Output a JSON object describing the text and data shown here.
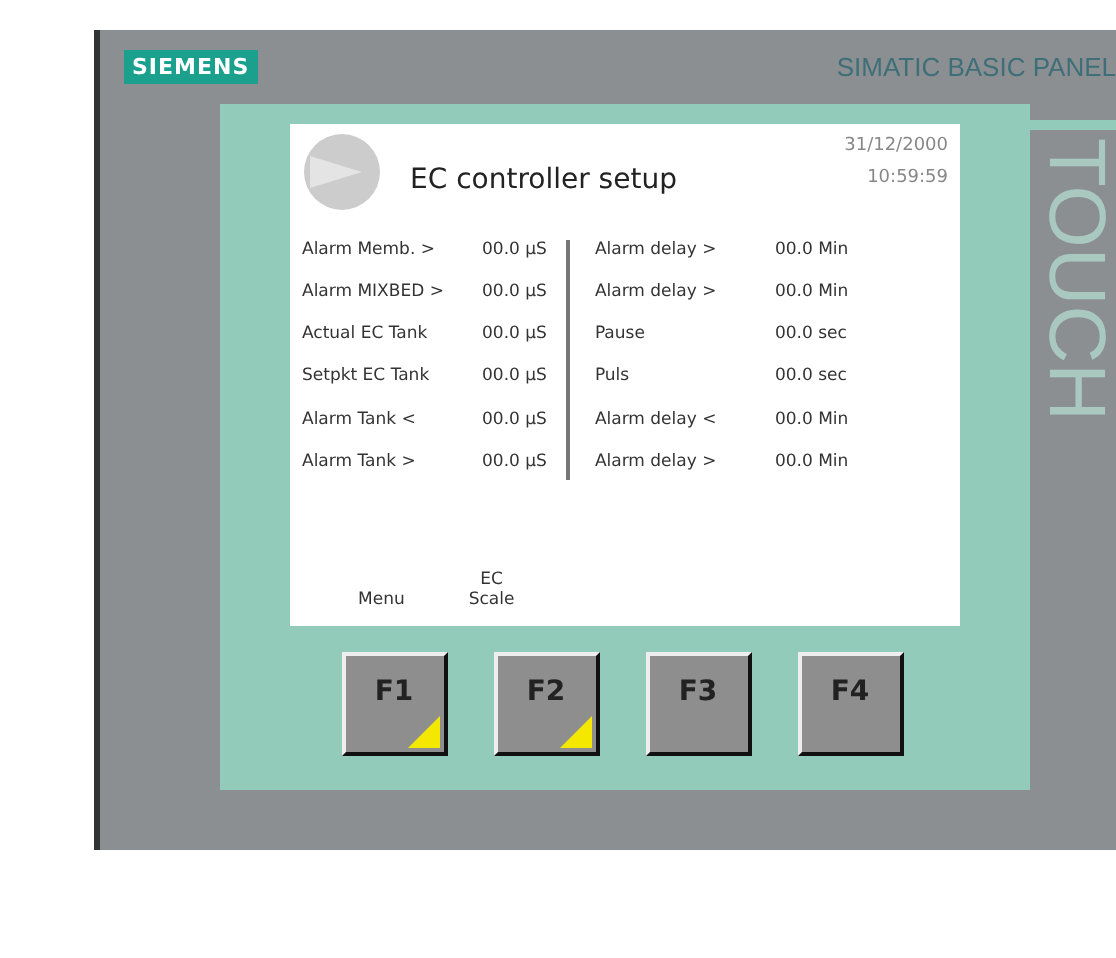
{
  "brand": "SIEMENS",
  "model": "SIMATIC BASIC PANEL",
  "side_label": "TOUCH",
  "screen": {
    "title": "EC controller setup",
    "date": "31/12/2000",
    "time": "10:59:59",
    "left_rows": [
      {
        "label": "Alarm Memb. >",
        "value": "00.0 µS"
      },
      {
        "label": "Alarm MIXBED >",
        "value": "00.0 µS"
      },
      {
        "label": "Actual EC Tank",
        "value": "00.0 µS"
      },
      {
        "label": "Setpkt EC Tank",
        "value": "00.0 µS"
      },
      {
        "label": "Alarm Tank <",
        "value": "00.0 µS"
      },
      {
        "label": "Alarm Tank >",
        "value": "00.0 µS"
      }
    ],
    "right_rows": [
      {
        "label": "Alarm delay >",
        "value": "00.0 Min"
      },
      {
        "label": "Alarm delay >",
        "value": "00.0 Min"
      },
      {
        "label": "Pause",
        "value": "00.0 sec"
      },
      {
        "label": "Puls",
        "value": "00.0 sec"
      },
      {
        "label": "Alarm delay <",
        "value": "00.0 Min"
      },
      {
        "label": "Alarm delay >",
        "value": "00.0 Min"
      }
    ],
    "softkeys": [
      "Menu",
      "EC\nScale"
    ]
  },
  "function_keys": [
    {
      "label": "F1",
      "marked": true
    },
    {
      "label": "F2",
      "marked": true
    },
    {
      "label": "F3",
      "marked": false
    },
    {
      "label": "F4",
      "marked": false
    }
  ]
}
